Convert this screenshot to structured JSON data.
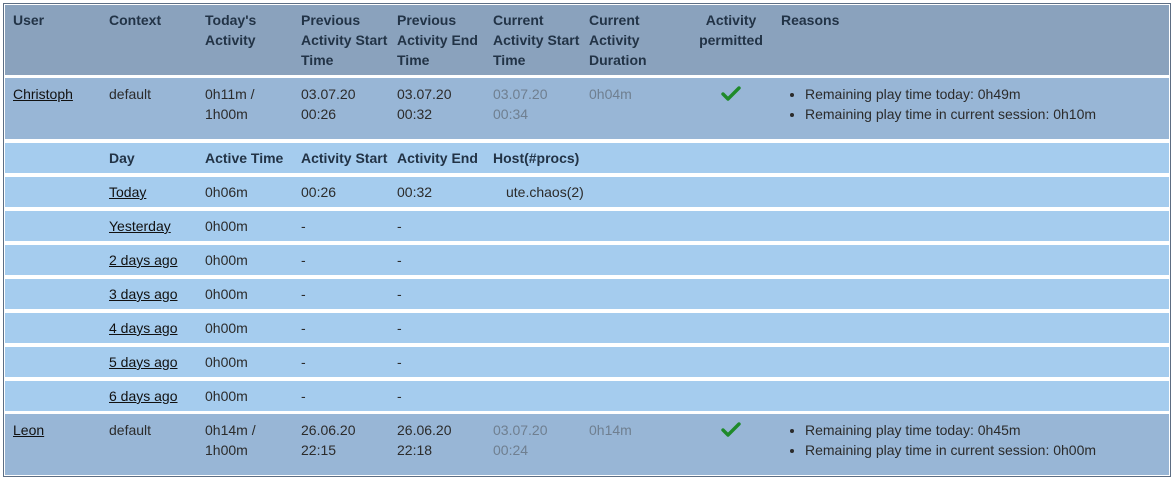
{
  "header": {
    "user": "User",
    "context": "Context",
    "todays_activity": [
      "Today's",
      "Activity"
    ],
    "prev_start": [
      "Previous",
      "Activity Start",
      "Time"
    ],
    "prev_end": [
      "Previous",
      "Activity End",
      "Time"
    ],
    "cur_start": [
      "Current",
      "Activity Start",
      "Time"
    ],
    "cur_duration": [
      "Current",
      "Activity",
      "Duration"
    ],
    "permitted": [
      "Activity",
      "permitted"
    ],
    "reasons": "Reasons"
  },
  "users": [
    {
      "name": "Christoph",
      "context": "default",
      "todays_activity": [
        "0h11m /",
        "1h00m"
      ],
      "prev_start": [
        "03.07.20",
        "00:26"
      ],
      "prev_end": [
        "03.07.20",
        "00:32"
      ],
      "cur_start": [
        "03.07.20",
        "00:34"
      ],
      "cur_duration": "0h04m",
      "permitted_icon": "check-icon",
      "reasons": [
        "Remaining play time today: 0h49m",
        "Remaining play time in current session: 0h10m"
      ]
    },
    {
      "name": "Leon",
      "context": "default",
      "todays_activity": [
        "0h14m /",
        "1h00m"
      ],
      "prev_start": [
        "26.06.20",
        "22:15"
      ],
      "prev_end": [
        "26.06.20",
        "22:18"
      ],
      "cur_start": [
        "03.07.20",
        "00:24"
      ],
      "cur_duration": "0h14m",
      "permitted_icon": "check-icon",
      "reasons": [
        "Remaining play time today: 0h45m",
        "Remaining play time in current session: 0h00m"
      ]
    }
  ],
  "detail": {
    "header": {
      "day": "Day",
      "active_time": "Active Time",
      "activity_start": "Activity Start",
      "activity_end": "Activity End",
      "host": "Host(#procs)"
    },
    "rows": [
      {
        "day": "Today",
        "active": "0h06m",
        "start": "00:26",
        "end": "00:32",
        "host": "ute.chaos(2)"
      },
      {
        "day": "Yesterday",
        "active": "0h00m",
        "start": "-",
        "end": "-",
        "host": ""
      },
      {
        "day": "2 days ago",
        "active": "0h00m",
        "start": "-",
        "end": "-",
        "host": ""
      },
      {
        "day": "3 days ago",
        "active": "0h00m",
        "start": "-",
        "end": "-",
        "host": ""
      },
      {
        "day": "4 days ago",
        "active": "0h00m",
        "start": "-",
        "end": "-",
        "host": ""
      },
      {
        "day": "5 days ago",
        "active": "0h00m",
        "start": "-",
        "end": "-",
        "host": ""
      },
      {
        "day": "6 days ago",
        "active": "0h00m",
        "start": "-",
        "end": "-",
        "host": ""
      }
    ]
  },
  "colors": {
    "header_bg": "#8aa2bd",
    "user_row_bg": "#98b6d6",
    "detail_row_bg": "#a5ccee",
    "check": "#1f8a2a"
  }
}
